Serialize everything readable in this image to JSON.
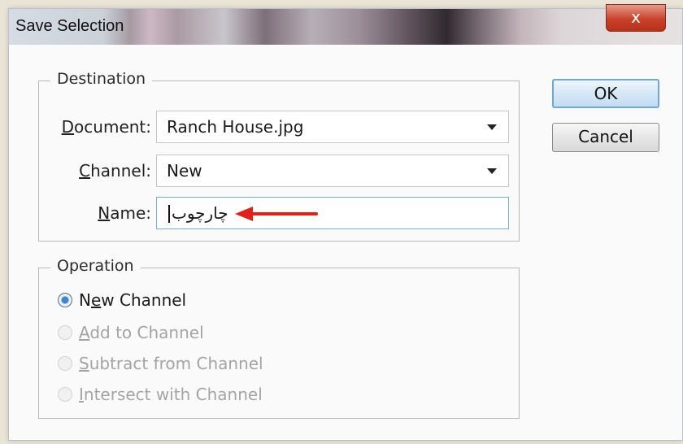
{
  "dialog": {
    "title": "Save Selection",
    "close_symbol": "x"
  },
  "destination": {
    "legend": "Destination",
    "document": {
      "label": "Document:",
      "value": "Ranch House.jpg"
    },
    "channel": {
      "label": "Channel:",
      "value": "New"
    },
    "name": {
      "label": "Name:",
      "value": "چارچوب"
    }
  },
  "buttons": {
    "ok": "OK",
    "cancel": "Cancel"
  },
  "operation": {
    "legend": "Operation",
    "options": [
      {
        "label": "New Channel",
        "checked": true,
        "enabled": true
      },
      {
        "label": "Add to Channel",
        "checked": false,
        "enabled": false
      },
      {
        "label": "Subtract from Channel",
        "checked": false,
        "enabled": false
      },
      {
        "label": "Intersect with Channel",
        "checked": false,
        "enabled": false
      }
    ]
  },
  "annotation": {
    "arrow_color": "#e0201c"
  }
}
